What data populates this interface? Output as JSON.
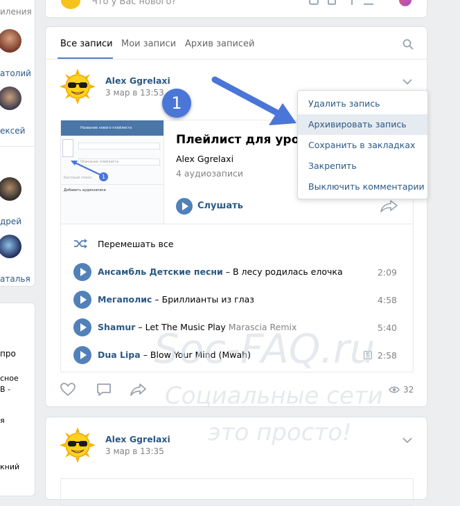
{
  "sidebar": {
    "top_label": "иления",
    "friends": [
      {
        "name": "атолий"
      },
      {
        "name": "ексей"
      },
      {
        "name": "дрей"
      },
      {
        "name": "аталья"
      }
    ],
    "text_items": [
      "про",
      "сное",
      "В -",
      "я",
      "кний"
    ]
  },
  "composer": {
    "placeholder": "Что у Вас нового?"
  },
  "tabs": {
    "all": "Все записи",
    "mine": "Мои записи",
    "archive": "Архив записей"
  },
  "post": {
    "author": "Alex Ggrelaxi",
    "date": "3 мар в 13:53",
    "step_number": "1",
    "playlist": {
      "title": "Плейлист для урока",
      "owner": "Alex Ggrelaxi",
      "count": "4 аудиозаписи",
      "listen_label": "Слушать",
      "thumb_title": "Название нового плейлиста",
      "thumb_desc": "Описание плейлиста",
      "thumb_step": "1",
      "thumb_add": "Добавить аудиозаписи",
      "thumb_search": "Быстрый поиск"
    },
    "shuffle_label": "Перемешать все",
    "tracks": [
      {
        "artist": "Ансамбль Детские песни",
        "sep": "–",
        "title": "В лесу родилась елочка",
        "subtitle": "",
        "duration": "2:09",
        "explicit": false
      },
      {
        "artist": "Мегаполис",
        "sep": "–",
        "title": "Бриллианты из глаз",
        "subtitle": "",
        "duration": "4:58",
        "explicit": false
      },
      {
        "artist": "Shamur",
        "sep": "–",
        "title": "Let The Music Play",
        "subtitle": "Marascia Remix",
        "duration": "5:40",
        "explicit": false
      },
      {
        "artist": "Dua Lipa",
        "sep": "–",
        "title": "Blow Your Mind (Mwah)",
        "subtitle": "",
        "duration": "2:58",
        "explicit": true
      }
    ],
    "explicit_badge": "E",
    "views": "32"
  },
  "menu": {
    "items": [
      "Удалить запись",
      "Архивировать запись",
      "Сохранить в закладках",
      "Закрепить",
      "Выключить комментарии"
    ]
  },
  "post2": {
    "author": "Alex Ggrelaxi",
    "date": "3 мар в 13:35"
  },
  "watermark": {
    "site": "Soc-FAQ.ru",
    "line1": "Социальные сети",
    "line2": "это просто!"
  },
  "colors": {
    "link": "#2a5885",
    "accent": "#5181b8",
    "arrow": "#4a76d8",
    "background": "#edeef0"
  }
}
